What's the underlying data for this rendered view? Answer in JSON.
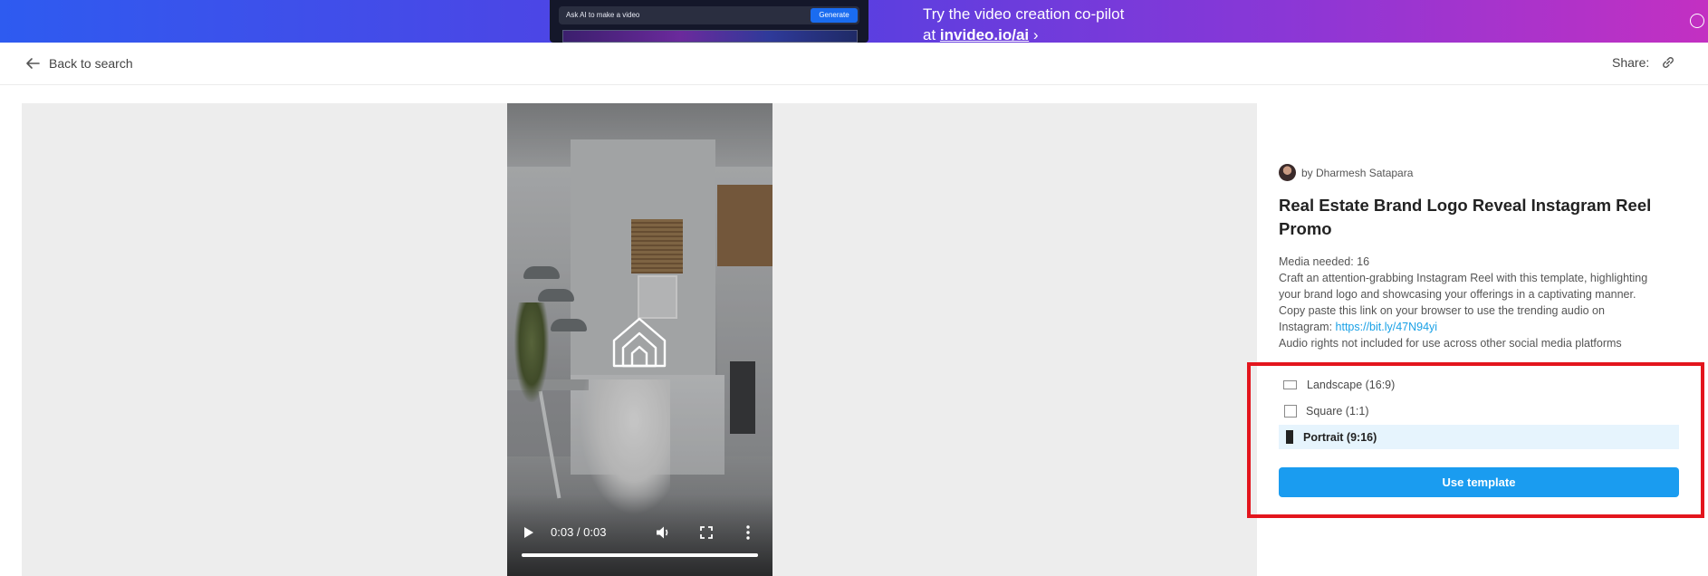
{
  "banner": {
    "mock_prompt": "Ask AI to make a video",
    "mock_button": "Generate",
    "line1": "Try the video creation co-pilot",
    "line2_prefix": "at ",
    "line2_link": "invideo.io/ai",
    "chevron": "›",
    "gradient_colors": [
      "#2e5bf0",
      "#5a3fe0",
      "#c330c2"
    ]
  },
  "topbar": {
    "back_label": "Back to search",
    "share_label": "Share:"
  },
  "video": {
    "time": "0:03 / 0:03",
    "progress": 1.0
  },
  "template": {
    "author": "by Dharmesh Satapara",
    "title": "Real Estate Brand Logo Reveal Instagram Reel Promo",
    "media_needed": "Media needed: 16",
    "desc_lines": [
      "Craft an attention-grabbing Instagram Reel with this template, highlighting",
      "your brand logo and showcasing your offerings in a captivating manner.",
      "Copy paste this link on your browser to use the trending audio on"
    ],
    "audio_prefix": "Instagram: ",
    "audio_link": "https://bit.ly/47N94yi",
    "rights_note": "Audio rights not included for use across other social media platforms"
  },
  "ratios": [
    {
      "label": "Landscape (16:9)",
      "selected": false
    },
    {
      "label": "Square (1:1)",
      "selected": false
    },
    {
      "label": "Portrait (9:16)",
      "selected": true
    }
  ],
  "use_button": "Use template",
  "colors": {
    "accent": "#1a9cf0",
    "link": "#1aa1e6",
    "selected_bg": "#e6f4fd",
    "highlight": "#e3151d"
  }
}
